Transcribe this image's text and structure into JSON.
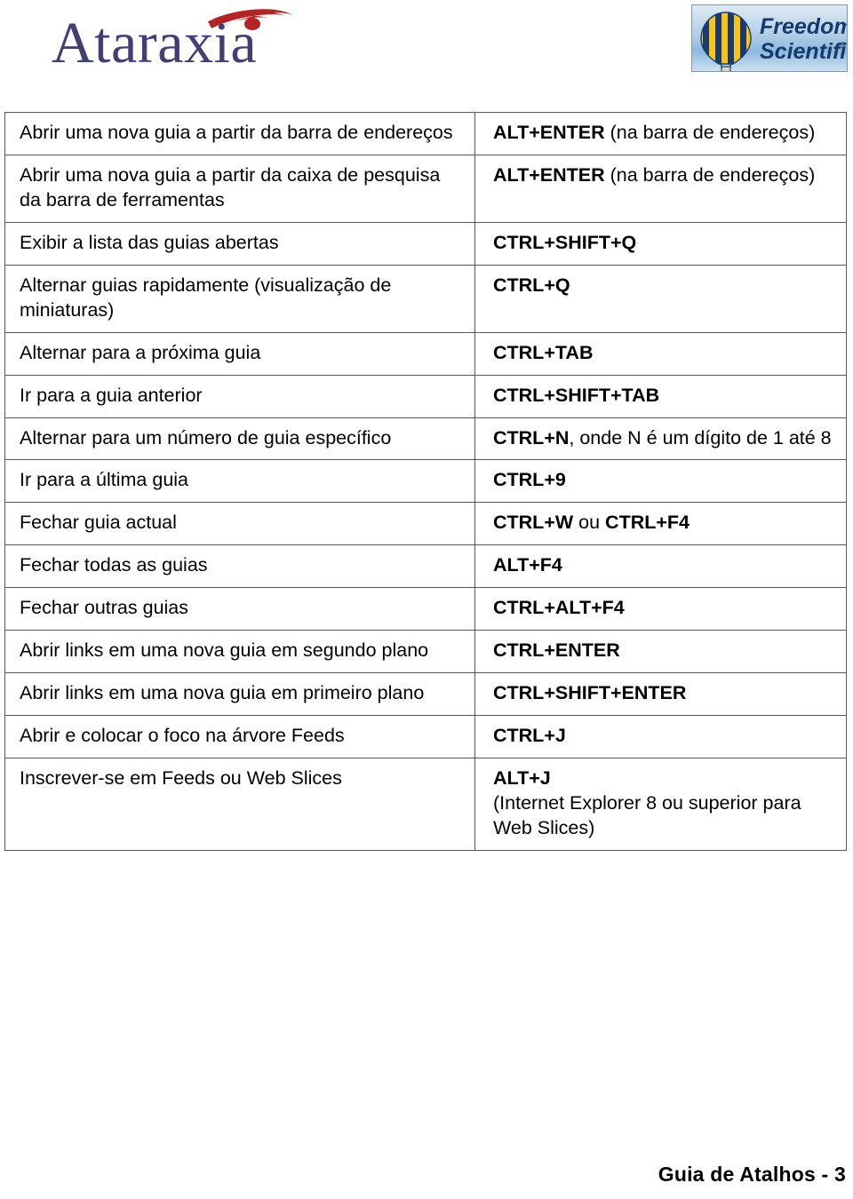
{
  "header": {
    "ataraxia_logo_text": "Ataraxia",
    "freedom_scientific": {
      "line1": "Freedom",
      "line2": "Scientific",
      "registered_mark": "®"
    },
    "colors": {
      "ataraxia_wordmark": "#433f72",
      "ataraxia_swoosh": "#b32429",
      "fs_text": "#173a6d",
      "fs_balloon_yellow": "#f5c518",
      "fs_balloon_blue": "#1b3a73",
      "fs_panel_border": "#7f97ac",
      "table_border": "#595959"
    }
  },
  "table": {
    "rows": [
      {
        "action": "Abrir uma nova guia a partir da barra de endereços",
        "keys": "ALT+ENTER",
        "note": " (na barra de endereços)",
        "note_on_new_line": false
      },
      {
        "action": "Abrir uma nova guia a partir da caixa de pesquisa da barra de ferramentas",
        "keys": "ALT+ENTER",
        "note": " (na barra de endereços)",
        "note_on_new_line": false
      },
      {
        "action": "Exibir a lista das guias abertas",
        "keys": "CTRL+SHIFT+Q",
        "note": "",
        "note_on_new_line": false
      },
      {
        "action": "Alternar guias rapidamente (visualização de miniaturas)",
        "keys": "CTRL+Q",
        "note": "",
        "note_on_new_line": false
      },
      {
        "action": "Alternar para a próxima guia",
        "keys": "CTRL+TAB",
        "note": "",
        "note_on_new_line": false
      },
      {
        "action": "Ir para a guia anterior",
        "keys": "CTRL+SHIFT+TAB",
        "note": "",
        "note_on_new_line": false
      },
      {
        "action": "Alternar para um número de guia específico",
        "keys": "CTRL+N",
        "note": ", onde N é um dígito de 1 até 8",
        "note_on_new_line": false
      },
      {
        "action": "Ir para a última guia",
        "keys": "CTRL+9",
        "note": "",
        "note_on_new_line": false
      },
      {
        "action": "Fechar guia actual",
        "keys": "CTRL+W",
        "note": " ou ",
        "keys2": "CTRL+F4",
        "note_on_new_line": false
      },
      {
        "action": "Fechar todas as guias",
        "keys": "ALT+F4",
        "note": "",
        "note_on_new_line": false
      },
      {
        "action": "Fechar outras guias",
        "keys": "CTRL+ALT+F4",
        "note": "",
        "note_on_new_line": false
      },
      {
        "action": "Abrir links em uma nova guia em segundo plano",
        "keys": "CTRL+ENTER",
        "note": "",
        "note_on_new_line": false
      },
      {
        "action": "Abrir links em uma nova guia em primeiro plano",
        "keys": "CTRL+SHIFT+ENTER",
        "note": "",
        "note_on_new_line": false
      },
      {
        "action": "Abrir e colocar o foco na árvore Feeds",
        "keys": "CTRL+J",
        "note": "",
        "note_on_new_line": false
      },
      {
        "action": "Inscrever-se em Feeds ou Web Slices",
        "keys": "ALT+J",
        "note": "(Internet Explorer 8 ou superior para Web Slices)",
        "note_on_new_line": true
      }
    ]
  },
  "footer": {
    "page_label": "Guia de Atalhos - 3"
  }
}
